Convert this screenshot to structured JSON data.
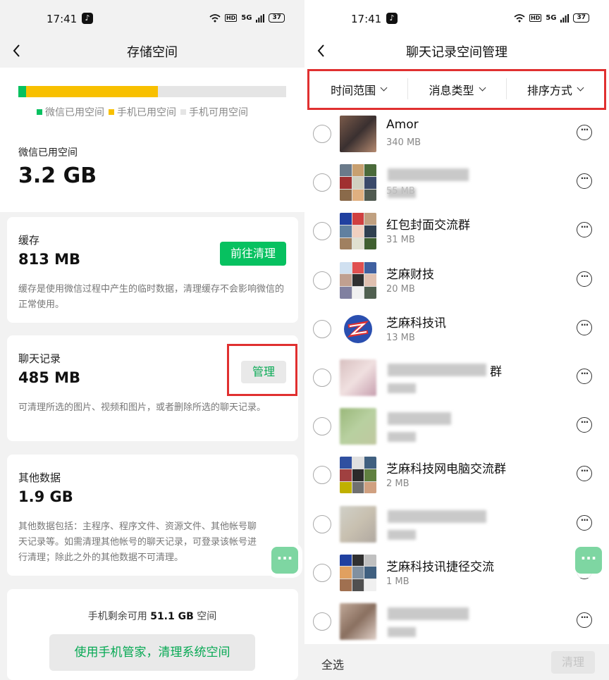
{
  "status": {
    "time": "17:41",
    "battery": "37",
    "signal": "5G",
    "hd": "HD",
    "tiktok": "♪"
  },
  "left": {
    "title": "存储空间",
    "storage_bar": {
      "wechat_fraction": 0.03,
      "phone_used_fraction": 0.49
    },
    "legend": [
      "微信已用空间",
      "手机已用空间",
      "手机可用空间"
    ],
    "colors": {
      "wechat": "#07c160",
      "phone_used": "#f8c000",
      "phone_free": "#e5e5e5",
      "accent": "#07c160",
      "highlight": "#e03030"
    },
    "used_label": "微信已用空间",
    "used_value": "3.2 GB",
    "cache": {
      "label": "缓存",
      "value": "813 MB",
      "button": "前往清理",
      "desc": "缓存是使用微信过程中产生的临时数据，清理缓存不会影响微信的正常使用。"
    },
    "chat": {
      "label": "聊天记录",
      "value": "485 MB",
      "button": "管理",
      "desc": "可清理所选的图片、视频和图片，或者删除所选的聊天记录。"
    },
    "other": {
      "label": "其他数据",
      "value": "1.9 GB",
      "desc": "其他数据包括：主程序、程序文件、资源文件、其他帐号聊天记录等。如需清理其他帐号的聊天记录，可登录该帐号进行清理；除此之外的其他数据不可清理。"
    },
    "phone_free_prefix": "手机剩余可用",
    "phone_free_value": "51.1 GB",
    "phone_free_suffix": "空间",
    "system_button": "使用手机管家，清理系统空间",
    "float_icon": "···"
  },
  "right": {
    "title": "聊天记录空间管理",
    "filters": [
      "时间范围",
      "消息类型",
      "排序方式"
    ],
    "chats": [
      {
        "name": "Amor",
        "size": "340 MB",
        "blurred": false
      },
      {
        "name": "",
        "size": "55 MB",
        "blurred": true
      },
      {
        "name": "红包封面交流群",
        "size": "31 MB",
        "blurred": false
      },
      {
        "name": "芝麻财技",
        "size": "20 MB",
        "blurred": false
      },
      {
        "name": "芝麻科技讯",
        "size": "13 MB",
        "blurred": false
      },
      {
        "name": "群",
        "size": "",
        "blurred": true
      },
      {
        "name": "",
        "size": "",
        "blurred": true
      },
      {
        "name": "芝麻科技网电脑交流群",
        "size": "2 MB",
        "blurred": false
      },
      {
        "name": "",
        "size": "",
        "blurred": true
      },
      {
        "name": "芝麻科技讯捷径交流",
        "size": "1 MB",
        "blurred": false
      },
      {
        "name": "",
        "size": "",
        "blurred": true
      }
    ],
    "more_icon": "···",
    "select_all": "全选",
    "clean_button": "清理",
    "float_icon": "···"
  }
}
